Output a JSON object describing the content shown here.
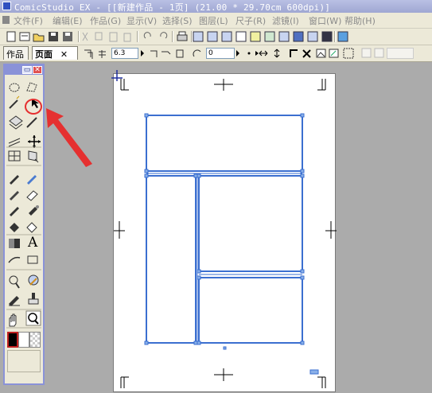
{
  "window": {
    "title": "ComicStudio EX - [[新建作品 - 1页] (21.00 * 29.70cm 600dpi)]"
  },
  "menu": {
    "items": [
      {
        "key": "file",
        "label": "文件(F)"
      },
      {
        "key": "edit",
        "label": "编辑(E)"
      },
      {
        "key": "story",
        "label": "作品(G)"
      },
      {
        "key": "view",
        "label": "显示(V)"
      },
      {
        "key": "select",
        "label": "选择(S)"
      },
      {
        "key": "layer",
        "label": "图层(L)"
      },
      {
        "key": "ruler",
        "label": "尺子(R)"
      },
      {
        "key": "filter",
        "label": "滤镜(I)"
      },
      {
        "key": "window",
        "label": "窗口(W)"
      },
      {
        "key": "help",
        "label": "帮助(H)"
      }
    ]
  },
  "toolbar": {
    "icons": [
      "new-file-icon",
      "open-icon",
      "folder-icon",
      "save-icon",
      "save-as-icon",
      "cut-icon",
      "copy-icon",
      "paste-icon",
      "delete-icon",
      "undo-icon",
      "redo-icon",
      "print-icon",
      "view1-icon",
      "view2-icon",
      "view3-icon",
      "view4-icon",
      "view5-icon",
      "view6-icon",
      "view7-icon",
      "view8-icon",
      "view9-icon",
      "view10-icon",
      "script-icon"
    ]
  },
  "tabs": {
    "story_label": "作品",
    "page_label": "页面",
    "close_symbol": "✕",
    "zoom_value": "6.3",
    "rotate_value": "0"
  },
  "colors": {
    "panel_border": "#3b6fd0",
    "annotation": "#e53030",
    "palette_border": "#8a92d8",
    "foreground_swatch": "#000000",
    "background_swatch": "#ffffff"
  },
  "palette": {
    "minimize_symbol": "▭",
    "close_symbol": "✕",
    "tools": [
      "lasso-icon",
      "polyline-lasso-icon",
      "magic-wand-icon",
      "object-selector-icon",
      "layer-move-icon",
      "eyedropper-icon",
      "ruler-icon",
      "move-icon",
      "frame-ruler-icon",
      "perspective-icon",
      "pen-icon",
      "pencil-icon",
      "marker-icon",
      "eraser-icon",
      "brush-icon",
      "airbrush-icon",
      "fill-icon",
      "pattern-fill-icon",
      "gradient-icon",
      "text-icon",
      "line-icon",
      "rectangle-icon",
      "balloon-icon",
      "effect-icon",
      "tone-eraser-icon",
      "stamp-icon",
      "hand-icon",
      "zoom-icon"
    ],
    "text_tool_glyph": "A"
  }
}
